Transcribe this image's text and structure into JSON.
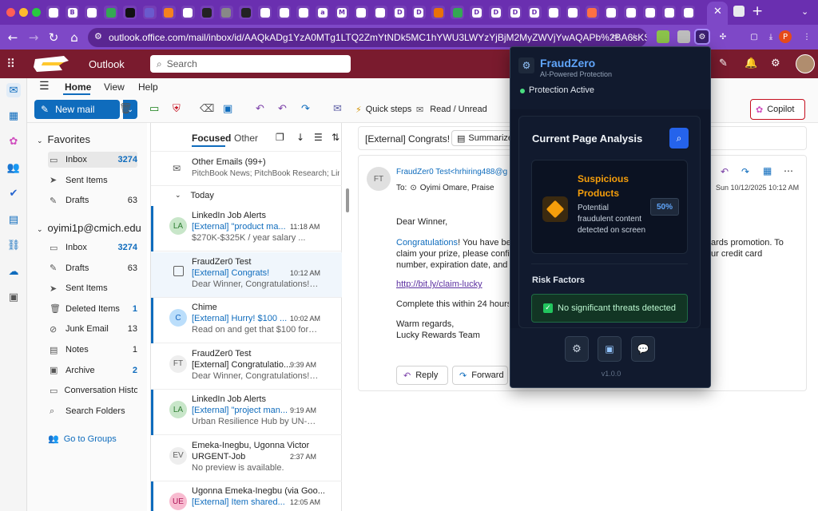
{
  "browser": {
    "url": "outlook.office.com/mail/inbox/id/AAQkADg1YzA0MTg1LTQ2ZmYtNDk5MC1hYWU3LWYzYjBjM2MyZWVjYwAQAPb%2BA6sKSJFOp...",
    "tabs": [
      {
        "label": "",
        "color": "#ffffff"
      },
      {
        "label": "B",
        "color": "#ffffff"
      },
      {
        "label": "",
        "color": "#ffffff"
      },
      {
        "label": "",
        "color": "#34a853"
      },
      {
        "label": "",
        "color": "#111111"
      },
      {
        "label": "",
        "color": "#6a5acd"
      },
      {
        "label": "",
        "color": "#f48120"
      },
      {
        "label": "",
        "color": "#ffffff"
      },
      {
        "label": "",
        "color": "#222222"
      },
      {
        "label": "",
        "color": "#888888"
      },
      {
        "label": "",
        "color": "#222222"
      },
      {
        "label": "",
        "color": "#ffffff"
      },
      {
        "label": "",
        "color": "#ffffff"
      },
      {
        "label": "",
        "color": "#ffffff"
      },
      {
        "label": "a",
        "color": "#ffffff"
      },
      {
        "label": "M",
        "color": "#ffffff"
      },
      {
        "label": "",
        "color": "#ffffff"
      },
      {
        "label": "",
        "color": "#ffffff"
      },
      {
        "label": "D",
        "color": "#ffffff"
      },
      {
        "label": "D",
        "color": "#ffffff"
      },
      {
        "label": "",
        "color": "#e8710a"
      },
      {
        "label": "",
        "color": "#34a853"
      },
      {
        "label": "D",
        "color": "#ffffff"
      },
      {
        "label": "D",
        "color": "#ffffff"
      },
      {
        "label": "D",
        "color": "#ffffff"
      },
      {
        "label": "D",
        "color": "#ffffff"
      },
      {
        "label": "",
        "color": "#ffffff"
      },
      {
        "label": "",
        "color": "#ffffff"
      },
      {
        "label": "",
        "color": "#ff7043"
      },
      {
        "label": "",
        "color": "#ffffff"
      },
      {
        "label": "",
        "color": "#ffffff"
      },
      {
        "label": "",
        "color": "#ffffff"
      },
      {
        "label": "",
        "color": "#ffffff"
      },
      {
        "label": "",
        "color": "#ffffff"
      }
    ],
    "profile_initial": "P"
  },
  "outlook": {
    "app_name": "Outlook",
    "search_placeholder": "Search",
    "menu": {
      "home": "Home",
      "view": "View",
      "help": "Help"
    },
    "ribbon": {
      "new_mail": "New mail",
      "quick_steps": "Quick steps",
      "read_unread": "Read / Unread",
      "copilot": "Copilot"
    },
    "favorites_label": "Favorites",
    "favorites": [
      {
        "label": "Inbox",
        "count": "3274",
        "icon": "inbox-icon",
        "blue": true,
        "selected": true
      },
      {
        "label": "Sent Items",
        "count": "",
        "icon": "send-icon",
        "blue": false
      },
      {
        "label": "Drafts",
        "count": "63",
        "icon": "pencil-icon",
        "blue": false
      }
    ],
    "account_label": "oyimi1p@cmich.edu",
    "account_folders": [
      {
        "label": "Inbox",
        "count": "3274",
        "blue": true
      },
      {
        "label": "Drafts",
        "count": "63",
        "blue": false
      },
      {
        "label": "Sent Items",
        "count": "",
        "blue": false
      },
      {
        "label": "Deleted Items",
        "count": "1",
        "blue": true
      },
      {
        "label": "Junk Email",
        "count": "13",
        "blue": false
      },
      {
        "label": "Notes",
        "count": "1",
        "blue": false
      },
      {
        "label": "Archive",
        "count": "2",
        "blue": true
      },
      {
        "label": "Conversation Histo...",
        "count": "",
        "blue": false
      },
      {
        "label": "Search Folders",
        "count": "",
        "blue": false
      }
    ],
    "go_to_groups": "Go to Groups",
    "list_tabs": {
      "focused": "Focused",
      "other": "Other"
    },
    "other_emails": {
      "title": "Other Emails (99+)",
      "preview": "PitchBook News; PitchBook Research; Link..."
    },
    "group_today": "Today",
    "messages": [
      {
        "initials": "LA",
        "avatar_bg": "#c8e6c9",
        "avatar_fg": "#2e7d32",
        "sender": "LinkedIn Job Alerts",
        "subject": "[External] \"product ma...",
        "time": "11:18 AM",
        "preview": "$270K-$325K / year salary       ...",
        "bar": true,
        "selected": false
      },
      {
        "initials": "",
        "avatar_bg": "",
        "avatar_fg": "",
        "sender": "FraudZer0 Test",
        "subject": "[External] Congrats!",
        "time": "10:12 AM",
        "preview": "Dear Winner, Congratulations! Yo...",
        "bar": false,
        "selected": true
      },
      {
        "initials": "C",
        "avatar_bg": "#bbdefb",
        "avatar_fg": "#1565c0",
        "sender": "Chime",
        "subject": "[External] Hurry! $100 ...",
        "time": "10:02 AM",
        "preview": "Read on and get that $100 for yo...",
        "bar": true,
        "selected": false
      },
      {
        "initials": "FT",
        "avatar_bg": "#eeeeee",
        "avatar_fg": "#616161",
        "sender": "FraudZer0 Test",
        "subject": "[External] Congratulatio...",
        "time": "9:39 AM",
        "preview": "Dear Winner, Congratulations! Yo...",
        "bar": false,
        "selected": false,
        "subject_plain": true
      },
      {
        "initials": "LA",
        "avatar_bg": "#c8e6c9",
        "avatar_fg": "#2e7d32",
        "sender": "LinkedIn Job Alerts",
        "subject": "[External] \"project man...",
        "time": "9:19 AM",
        "preview": "Urban Resilience Hub by UN-Habi...",
        "bar": true,
        "selected": false
      },
      {
        "initials": "EV",
        "avatar_bg": "#eeeeee",
        "avatar_fg": "#616161",
        "sender": "Emeka-Inegbu, Ugonna Victor",
        "subject": "URGENT-Job",
        "time": "2:37 AM",
        "preview": "No preview is available.",
        "bar": false,
        "selected": false,
        "subject_plain": true
      },
      {
        "initials": "UE",
        "avatar_bg": "#f8bbd0",
        "avatar_fg": "#ad1457",
        "sender": "Ugonna Emeka-Inegbu (via Goo...",
        "subject": "[External] Item shared...",
        "time": "12:05 AM",
        "preview": "",
        "bar": true,
        "selected": false
      }
    ],
    "reading": {
      "subject": "[External] Congrats!",
      "summarize": "Summarize",
      "avatar": "FT",
      "from": "FraudZer0 Test<hrhiring488@g",
      "to_label": "To:",
      "to": "Oyimi Omare, Praise",
      "date": "Sun 10/12/2025 10:12 AM",
      "greeting": "Dear Winner,",
      "para_link": "Congratulations",
      "para_a": "! You have bee",
      "para_b": "ards promotion. To",
      "para_line2a": "claim your prize, please confi",
      "para_line2b": "ur credit card",
      "para_line3": "number, expiration date, and C",
      "link": "http://bit.ly/claim-lucky",
      "complete": "Complete this within 24 hours",
      "sign1": "Warm regards,",
      "sign2": "Lucky Rewards Team",
      "reply": "Reply",
      "forward": "Forward"
    }
  },
  "popup": {
    "title": "FraudZero",
    "subtitle": "AI-Powered Protection",
    "status": "Protection Active",
    "analysis_title": "Current Page Analysis",
    "verdict_title": "Suspicious Products",
    "verdict_desc": "Potential fraudulent content detected on screen",
    "score": "50%",
    "risk_title": "Risk Factors",
    "risk_ok": "No significant threats detected",
    "version": "v1.0.0",
    "colors": {
      "accent": "#60a5fa",
      "warning": "#f59e0b",
      "ok": "#4ade80"
    }
  }
}
